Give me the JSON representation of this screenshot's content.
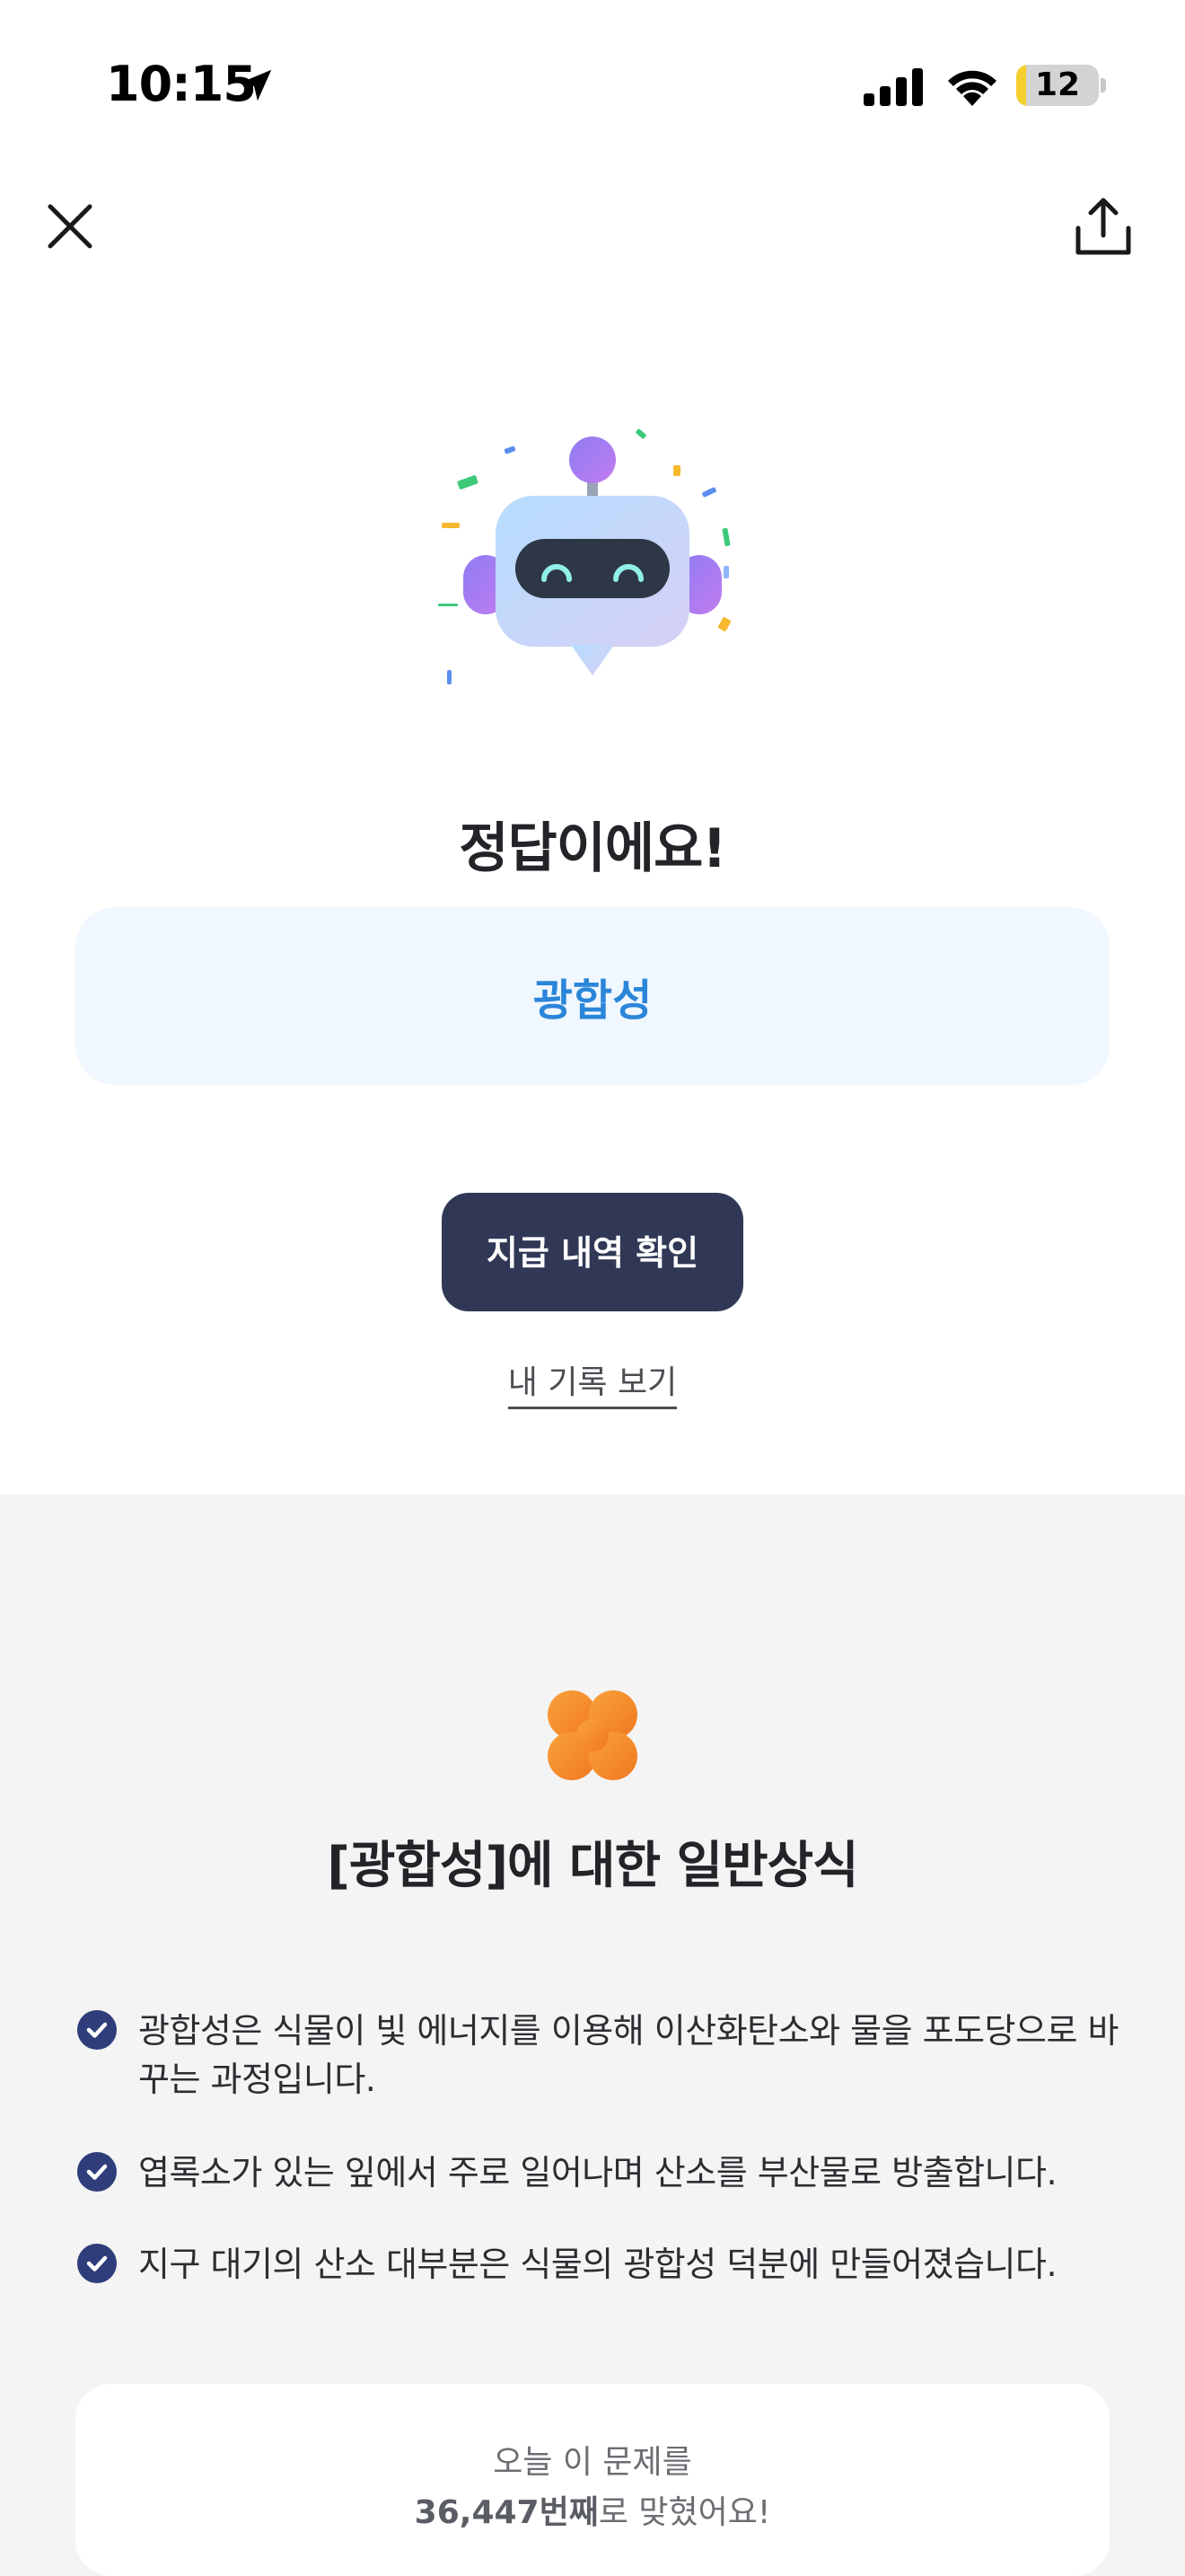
{
  "status_bar": {
    "time": "10:15",
    "battery_level": "12",
    "battery_fraction": 0.12,
    "icons": [
      "location-arrow-icon",
      "cellular-signal-icon",
      "wifi-icon",
      "battery-icon"
    ]
  },
  "nav": {
    "icons": [
      "close-icon",
      "share-icon"
    ]
  },
  "result": {
    "title": "정답이에요!",
    "answer": "광합성",
    "primary_button": "지급 내역 확인",
    "history_link": "내 기록 보기"
  },
  "info": {
    "heading": "[광합성]에 대한 일반상식",
    "facts": [
      "광합성은 식물이 빛 에너지를 이용해 이산화탄소와 물을 포도당으로 바꾸는 과정입니다.",
      "엽록소가 있는 잎에서 주로 일어나며 산소를 부산물로 방출합니다.",
      "지구 대기의 산소 대부분은 식물의 광합성 덕분에 만들어졌습니다."
    ]
  },
  "stats": {
    "line1": "오늘 이 문제를",
    "count": "36,447번째",
    "line2_suffix": "로 맞혔어요!"
  },
  "colors": {
    "accent_blue": "#2b86d9",
    "button_navy": "#303856",
    "check_navy": "#2f3d7a",
    "clover_orange": "#f58a2a"
  }
}
